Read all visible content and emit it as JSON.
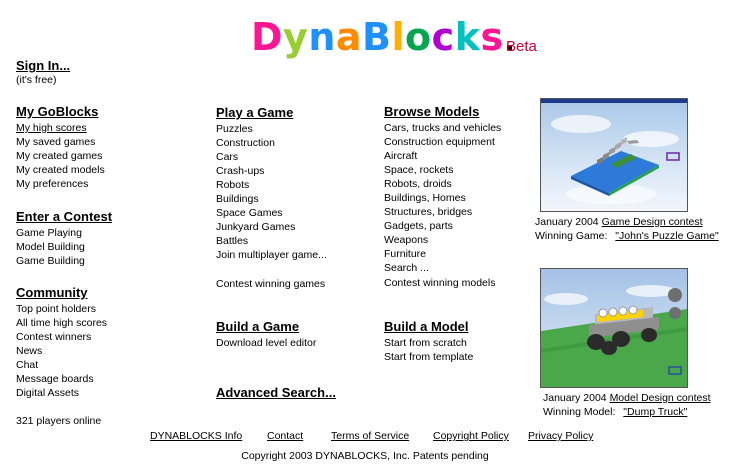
{
  "logo": {
    "letters": [
      {
        "ch": "D",
        "color": "#ff1493"
      },
      {
        "ch": "y",
        "color": "#9acd32"
      },
      {
        "ch": "n",
        "color": "#1e90ff"
      },
      {
        "ch": "a",
        "color": "#ff8c00"
      },
      {
        "ch": "B",
        "color": "#1e90ff"
      },
      {
        "ch": "l",
        "color": "#ffb000"
      },
      {
        "ch": "o",
        "color": "#00a550"
      },
      {
        "ch": "c",
        "color": "#b000d0"
      },
      {
        "ch": "k",
        "color": "#00c0c0"
      },
      {
        "ch": "s",
        "color": "#ff1493"
      }
    ],
    "beta": "Beta"
  },
  "signin": {
    "label": "Sign In...",
    "note": "(it's free)"
  },
  "mygoblocks": {
    "heading": "My GoBlocks",
    "items": [
      "My high scores",
      "My saved games",
      "My created games",
      "My created models",
      "My preferences"
    ]
  },
  "contest": {
    "heading": "Enter a Contest",
    "items": [
      "Game Playing",
      "Model Building",
      "Game Building"
    ]
  },
  "community": {
    "heading": "Community",
    "items": [
      "Top point holders",
      "All time high scores",
      "Contest winners",
      "News",
      "Chat",
      "Message boards",
      "Digital Assets"
    ]
  },
  "players_online": "321 players online",
  "play": {
    "heading": "Play a Game",
    "items": [
      "Puzzles",
      "Construction",
      "Cars",
      "Crash-ups",
      "Robots",
      "Buildings",
      "Space Games",
      "Junkyard Games",
      "Battles",
      "Join multiplayer game..."
    ],
    "extra": "Contest winning games"
  },
  "buildgame": {
    "heading": "Build a Game",
    "items": [
      "Download level editor"
    ]
  },
  "advanced_search": "Advanced Search...",
  "browse": {
    "heading": "Browse Models",
    "items": [
      "Cars, trucks and vehicles",
      "Construction equipment",
      "Aircraft",
      "Space, rockets",
      "Robots, droids",
      "Buildings, Homes",
      "Structures, bridges",
      "Gadgets, parts",
      "Weapons",
      "Furniture",
      "Search ..."
    ],
    "extra": "Contest winning models"
  },
  "buildmodel": {
    "heading": "Build a Model",
    "items": [
      "Start from scratch",
      "Start from template"
    ]
  },
  "contest1": {
    "date": "January 2004",
    "link": "Game Design contest",
    "winner_label": "Winning Game:",
    "winner": "\"John's Puzzle Game\""
  },
  "contest2": {
    "date": "January 2004",
    "link": "Model Design contest",
    "winner_label": "Winning Model:",
    "winner": "\"Dump Truck\""
  },
  "footer": {
    "links": [
      "DYNABLOCKS Info",
      "Contact",
      "Terms of Service",
      "Copyright Policy",
      "Privacy Policy"
    ],
    "copyright": "Copyright 2003 DYNABLOCKS, Inc.  Patents pending"
  }
}
